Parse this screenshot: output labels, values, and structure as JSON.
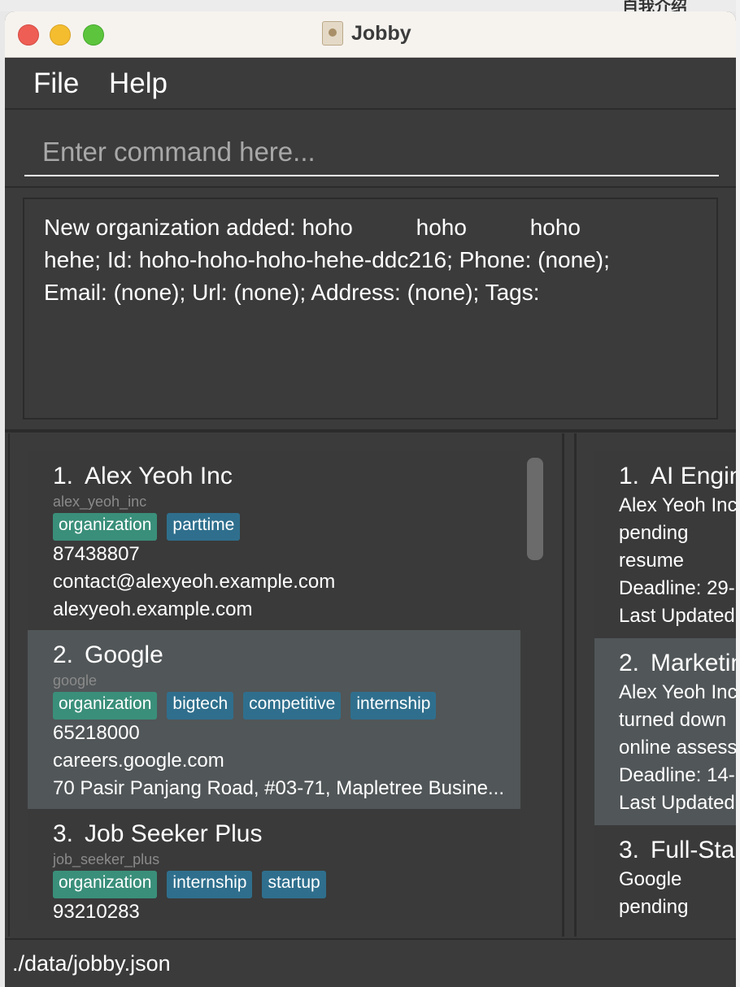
{
  "window": {
    "title": "Jobby"
  },
  "menu": {
    "file": "File",
    "help": "Help"
  },
  "command": {
    "placeholder": "Enter command here..."
  },
  "result": "New organization added: hoho          hoho          hoho\nhehe; Id: hoho-hoho-hoho-hehe-ddc216; Phone: (none);\nEmail: (none); Url: (none); Address: (none); Tags:",
  "organizations": [
    {
      "num": "1.",
      "name": "Alex Yeoh Inc",
      "id": "alex_yeoh_inc",
      "tags": [
        "organization",
        "parttime"
      ],
      "lines": [
        "87438807",
        "contact@alexyeoh.example.com",
        "alexyeoh.example.com"
      ]
    },
    {
      "num": "2.",
      "name": "Google",
      "id": "google",
      "tags": [
        "organization",
        "bigtech",
        "competitive",
        "internship"
      ],
      "lines": [
        "65218000",
        "careers.google.com",
        "70 Pasir Panjang Road, #03-71, Mapletree Busine..."
      ]
    },
    {
      "num": "3.",
      "name": "Job Seeker Plus",
      "id": "job_seeker_plus",
      "tags": [
        "organization",
        "internship",
        "startup"
      ],
      "lines": [
        "93210283"
      ]
    }
  ],
  "applications": [
    {
      "num": "1.",
      "title": "AI Engin",
      "lines": [
        "Alex Yeoh Inc",
        "pending",
        "resume",
        "Deadline: 29-",
        "Last Updated"
      ]
    },
    {
      "num": "2.",
      "title": "Marketin",
      "lines": [
        "Alex Yeoh Inc",
        "turned down",
        "online assess",
        "Deadline: 14-",
        "Last Updated"
      ]
    },
    {
      "num": "3.",
      "title": "Full-Sta",
      "lines": [
        "Google",
        "pending"
      ]
    }
  ],
  "status": "./data/jobby.json",
  "background": {
    "cjk_text": "自我介绍"
  },
  "colors": {
    "tag_org": "#3a8f7a",
    "tag_other": "#2f6f8d",
    "panel": "#3b3b3b",
    "selected": "#515658"
  }
}
